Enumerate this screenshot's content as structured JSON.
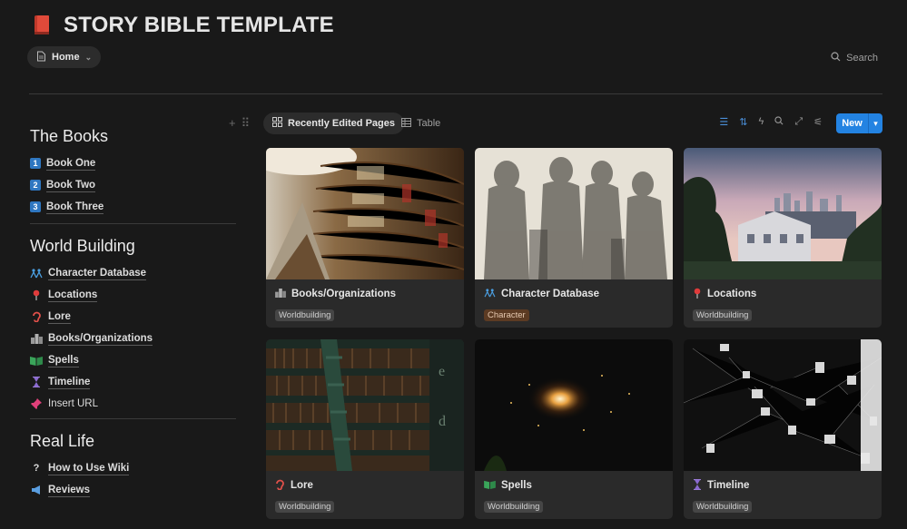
{
  "header": {
    "title": "STORY BIBLE TEMPLATE",
    "title_icon": "red-book-icon",
    "breadcrumb_label": "Home",
    "search_label": "Search"
  },
  "sidebar": {
    "sections": [
      {
        "title": "The Books",
        "items": [
          {
            "label": "Book One",
            "icon": "1"
          },
          {
            "label": "Book Two",
            "icon": "2"
          },
          {
            "label": "Book Three",
            "icon": "3"
          }
        ]
      },
      {
        "title": "World Building",
        "items": [
          {
            "label": "Character Database",
            "icon": "people-icon"
          },
          {
            "label": "Locations",
            "icon": "pin-icon"
          },
          {
            "label": "Lore",
            "icon": "ear-icon"
          },
          {
            "label": "Books/Organizations",
            "icon": "buildings-icon"
          },
          {
            "label": "Spells",
            "icon": "open-book-icon"
          },
          {
            "label": "Timeline",
            "icon": "hourglass-icon"
          },
          {
            "label": "Insert URL",
            "icon": "pin-pushpin-icon"
          }
        ]
      },
      {
        "title": "Real Life",
        "items": [
          {
            "label": "How to Use Wiki",
            "icon": "question-icon"
          },
          {
            "label": "Reviews",
            "icon": "megaphone-icon"
          }
        ]
      }
    ]
  },
  "toolbar": {
    "tab_gallery": "Recently Edited Pages",
    "tab_table": "Table",
    "new_label": "New"
  },
  "cards": [
    {
      "title": "Books/Organizations",
      "tag": "Worldbuilding",
      "icon": "buildings-icon"
    },
    {
      "title": "Character Database",
      "tag": "Character",
      "icon": "people-icon"
    },
    {
      "title": "Locations",
      "tag": "Worldbuilding",
      "icon": "pin-icon"
    },
    {
      "title": "Lore",
      "tag": "Worldbuilding",
      "icon": "ear-icon"
    },
    {
      "title": "Spells",
      "tag": "Worldbuilding",
      "icon": "open-book-icon"
    },
    {
      "title": "Timeline",
      "tag": "Worldbuilding",
      "icon": "hourglass-icon"
    }
  ],
  "colors": {
    "background": "#191919",
    "accent_blue": "#2383e2",
    "card_bg": "#2a2a2a",
    "tag_character": "#5c3b23"
  }
}
